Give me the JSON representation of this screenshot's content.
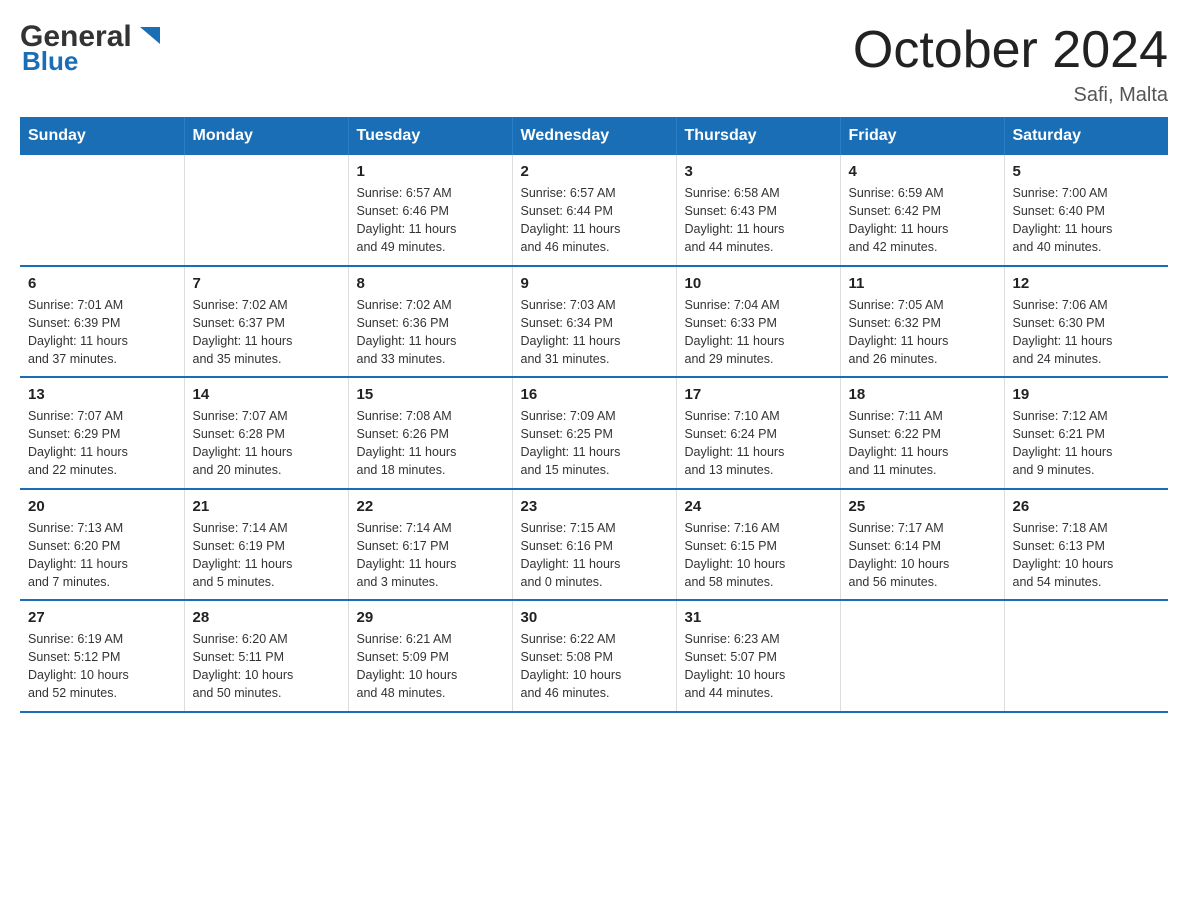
{
  "logo": {
    "general": "General",
    "blue": "Blue",
    "triangle_color": "#1a6eb5"
  },
  "title": "October 2024",
  "subtitle": "Safi, Malta",
  "days_of_week": [
    "Sunday",
    "Monday",
    "Tuesday",
    "Wednesday",
    "Thursday",
    "Friday",
    "Saturday"
  ],
  "weeks": [
    [
      {
        "day": "",
        "info": ""
      },
      {
        "day": "",
        "info": ""
      },
      {
        "day": "1",
        "info": "Sunrise: 6:57 AM\nSunset: 6:46 PM\nDaylight: 11 hours\nand 49 minutes."
      },
      {
        "day": "2",
        "info": "Sunrise: 6:57 AM\nSunset: 6:44 PM\nDaylight: 11 hours\nand 46 minutes."
      },
      {
        "day": "3",
        "info": "Sunrise: 6:58 AM\nSunset: 6:43 PM\nDaylight: 11 hours\nand 44 minutes."
      },
      {
        "day": "4",
        "info": "Sunrise: 6:59 AM\nSunset: 6:42 PM\nDaylight: 11 hours\nand 42 minutes."
      },
      {
        "day": "5",
        "info": "Sunrise: 7:00 AM\nSunset: 6:40 PM\nDaylight: 11 hours\nand 40 minutes."
      }
    ],
    [
      {
        "day": "6",
        "info": "Sunrise: 7:01 AM\nSunset: 6:39 PM\nDaylight: 11 hours\nand 37 minutes."
      },
      {
        "day": "7",
        "info": "Sunrise: 7:02 AM\nSunset: 6:37 PM\nDaylight: 11 hours\nand 35 minutes."
      },
      {
        "day": "8",
        "info": "Sunrise: 7:02 AM\nSunset: 6:36 PM\nDaylight: 11 hours\nand 33 minutes."
      },
      {
        "day": "9",
        "info": "Sunrise: 7:03 AM\nSunset: 6:34 PM\nDaylight: 11 hours\nand 31 minutes."
      },
      {
        "day": "10",
        "info": "Sunrise: 7:04 AM\nSunset: 6:33 PM\nDaylight: 11 hours\nand 29 minutes."
      },
      {
        "day": "11",
        "info": "Sunrise: 7:05 AM\nSunset: 6:32 PM\nDaylight: 11 hours\nand 26 minutes."
      },
      {
        "day": "12",
        "info": "Sunrise: 7:06 AM\nSunset: 6:30 PM\nDaylight: 11 hours\nand 24 minutes."
      }
    ],
    [
      {
        "day": "13",
        "info": "Sunrise: 7:07 AM\nSunset: 6:29 PM\nDaylight: 11 hours\nand 22 minutes."
      },
      {
        "day": "14",
        "info": "Sunrise: 7:07 AM\nSunset: 6:28 PM\nDaylight: 11 hours\nand 20 minutes."
      },
      {
        "day": "15",
        "info": "Sunrise: 7:08 AM\nSunset: 6:26 PM\nDaylight: 11 hours\nand 18 minutes."
      },
      {
        "day": "16",
        "info": "Sunrise: 7:09 AM\nSunset: 6:25 PM\nDaylight: 11 hours\nand 15 minutes."
      },
      {
        "day": "17",
        "info": "Sunrise: 7:10 AM\nSunset: 6:24 PM\nDaylight: 11 hours\nand 13 minutes."
      },
      {
        "day": "18",
        "info": "Sunrise: 7:11 AM\nSunset: 6:22 PM\nDaylight: 11 hours\nand 11 minutes."
      },
      {
        "day": "19",
        "info": "Sunrise: 7:12 AM\nSunset: 6:21 PM\nDaylight: 11 hours\nand 9 minutes."
      }
    ],
    [
      {
        "day": "20",
        "info": "Sunrise: 7:13 AM\nSunset: 6:20 PM\nDaylight: 11 hours\nand 7 minutes."
      },
      {
        "day": "21",
        "info": "Sunrise: 7:14 AM\nSunset: 6:19 PM\nDaylight: 11 hours\nand 5 minutes."
      },
      {
        "day": "22",
        "info": "Sunrise: 7:14 AM\nSunset: 6:17 PM\nDaylight: 11 hours\nand 3 minutes."
      },
      {
        "day": "23",
        "info": "Sunrise: 7:15 AM\nSunset: 6:16 PM\nDaylight: 11 hours\nand 0 minutes."
      },
      {
        "day": "24",
        "info": "Sunrise: 7:16 AM\nSunset: 6:15 PM\nDaylight: 10 hours\nand 58 minutes."
      },
      {
        "day": "25",
        "info": "Sunrise: 7:17 AM\nSunset: 6:14 PM\nDaylight: 10 hours\nand 56 minutes."
      },
      {
        "day": "26",
        "info": "Sunrise: 7:18 AM\nSunset: 6:13 PM\nDaylight: 10 hours\nand 54 minutes."
      }
    ],
    [
      {
        "day": "27",
        "info": "Sunrise: 6:19 AM\nSunset: 5:12 PM\nDaylight: 10 hours\nand 52 minutes."
      },
      {
        "day": "28",
        "info": "Sunrise: 6:20 AM\nSunset: 5:11 PM\nDaylight: 10 hours\nand 50 minutes."
      },
      {
        "day": "29",
        "info": "Sunrise: 6:21 AM\nSunset: 5:09 PM\nDaylight: 10 hours\nand 48 minutes."
      },
      {
        "day": "30",
        "info": "Sunrise: 6:22 AM\nSunset: 5:08 PM\nDaylight: 10 hours\nand 46 minutes."
      },
      {
        "day": "31",
        "info": "Sunrise: 6:23 AM\nSunset: 5:07 PM\nDaylight: 10 hours\nand 44 minutes."
      },
      {
        "day": "",
        "info": ""
      },
      {
        "day": "",
        "info": ""
      }
    ]
  ]
}
